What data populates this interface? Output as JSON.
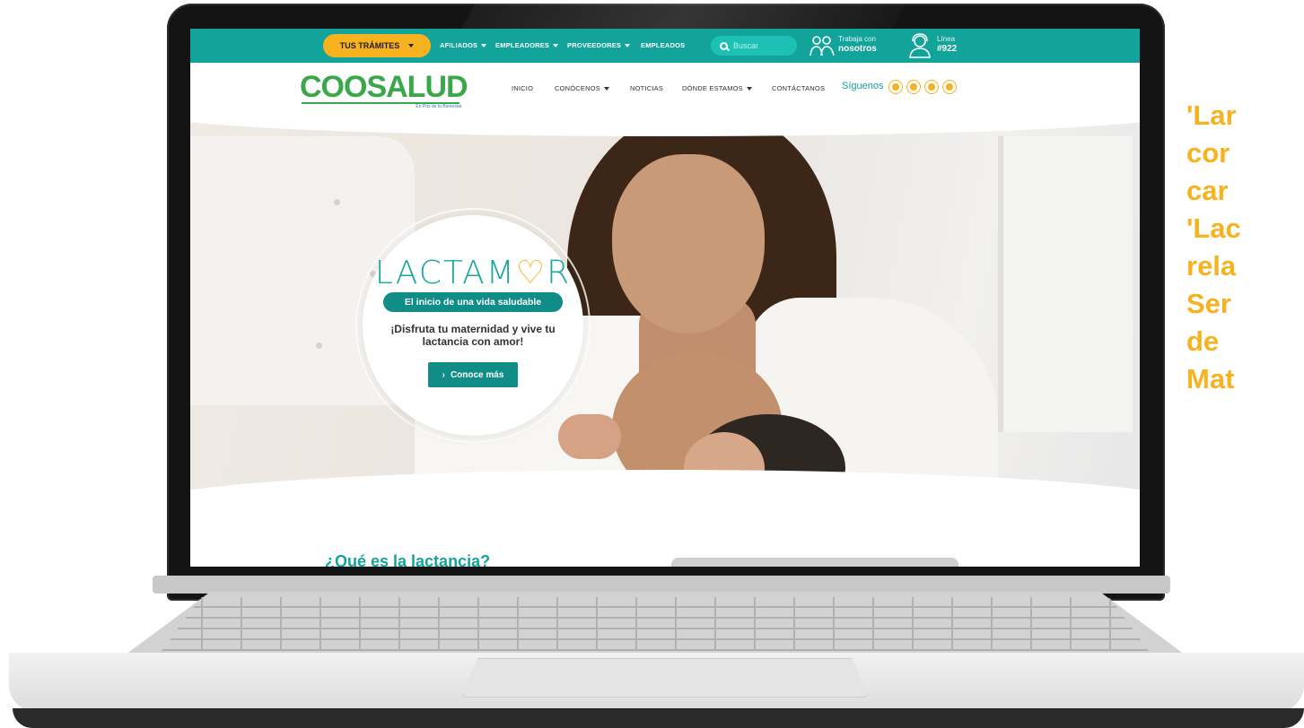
{
  "topbar": {
    "tramites_label": "TUS TRÁMITES",
    "nav": [
      "AFILIADOS",
      "EMPLEADORES",
      "PROVEEDORES",
      "EMPLEADOS"
    ],
    "search_placeholder": "Buscar",
    "trabaja_small": "Trabaja con",
    "trabaja_big": "nosotros",
    "linea_small": "Línea",
    "linea_big": "#922"
  },
  "header": {
    "logo_text": "COOSALUD",
    "logo_tagline": "En Pos de tu Bienestar",
    "menu": [
      "INICIO",
      "CONÓCENOS",
      "NOTICIAS",
      "DÓNDE ESTAMOS",
      "CONTÁCTANOS"
    ],
    "siguenos": "Síguenos",
    "social_icons": [
      "facebook-icon",
      "twitter-icon",
      "youtube-icon",
      "instagram-icon"
    ]
  },
  "hero": {
    "brand_prefix": "LACTAM",
    "brand_heart": "♡",
    "brand_suffix": "R",
    "pill": "El inicio de una vida saludable",
    "headline": "¡Disfruta tu maternidad y vive tu lactancia con amor!",
    "cta": "Conoce más"
  },
  "section": {
    "title": "¿Qué es la lactancia?"
  },
  "side_text": "'Lar\ncor\ncar\n'Lac\nrela\nSer\nde \nMat",
  "colors": {
    "teal": "#12a39a",
    "teal_dark": "#0f8d86",
    "yellow": "#f6b21f",
    "green": "#3aa84a"
  }
}
